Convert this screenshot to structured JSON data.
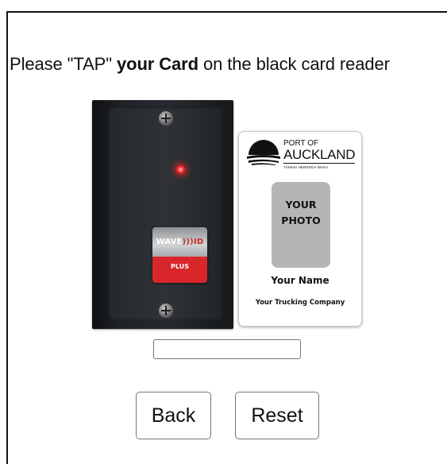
{
  "prompt": {
    "part1": "Please \"TAP\" ",
    "bold": "your Card",
    "part2": " on the black card reader"
  },
  "reader": {
    "brand_left": "WAVE",
    "brand_right": "ID",
    "model": "PLUS",
    "led_color": "#ff3030",
    "badge_color": "#d8262b"
  },
  "id_card": {
    "org_line1": "PORT OF",
    "org_line2": "AUCKLAND",
    "org_subtitle": "TĀMAKI HERENGA WAKA",
    "photo_line1": "YOUR",
    "photo_line2": "PHOTO",
    "name": "Your Name",
    "company": "Your Trucking Company"
  },
  "card_input": {
    "value": ""
  },
  "buttons": {
    "back": "Back",
    "reset": "Reset"
  }
}
